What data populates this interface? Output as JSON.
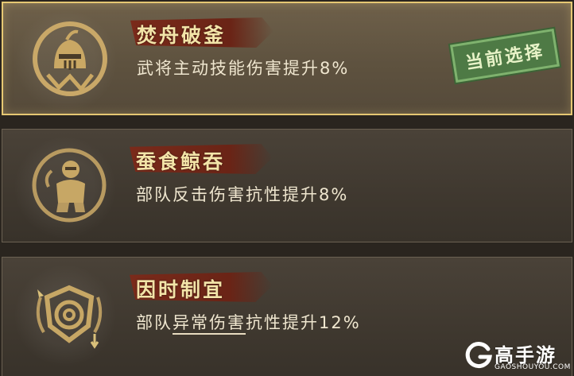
{
  "cards": [
    {
      "title": "焚舟破釜",
      "desc": "武将主动技能伤害提升8%",
      "icon": "knight-helmet-icon",
      "selected": true,
      "badge": "当前选择"
    },
    {
      "title": "蚕食鲸吞",
      "desc": "部队反击伤害抗性提升8%",
      "icon": "armored-soldier-icon"
    },
    {
      "title": "因时制宜",
      "desc_prefix": "部队",
      "desc_underlined": "异常伤害",
      "desc_suffix": "抗性提升12%",
      "icon": "shield-spiral-icon"
    }
  ],
  "watermark": {
    "brand": "高手游",
    "site": "GAOSHOUYOU.COM"
  },
  "colors": {
    "selected_border": "#e6c873",
    "title_ribbon": "#7a2a1a",
    "badge_green": "#4e7a45"
  }
}
